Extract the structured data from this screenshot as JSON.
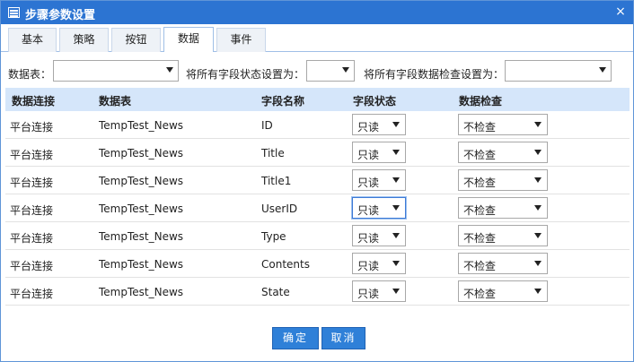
{
  "window": {
    "title": "步骤参数设置",
    "icon": "table-icon",
    "close_glyph": "×"
  },
  "tabs": [
    {
      "label": "基本",
      "active": false
    },
    {
      "label": "策略",
      "active": false
    },
    {
      "label": "按钮",
      "active": false
    },
    {
      "label": "数据",
      "active": true
    },
    {
      "label": "事件",
      "active": false
    }
  ],
  "filters": {
    "table_label": "数据表：",
    "table_value": "",
    "field_status_label": "将所有字段状态设置为：",
    "field_status_value": "",
    "field_check_label": "将所有字段数据检查设置为：",
    "field_check_value": ""
  },
  "grid": {
    "columns": [
      "数据连接",
      "数据表",
      "字段名称",
      "字段状态",
      "数据检查"
    ],
    "rows": [
      {
        "connection": "平台连接",
        "table": "TempTest_News",
        "field": "ID",
        "status": "只读",
        "check": "不检查"
      },
      {
        "connection": "平台连接",
        "table": "TempTest_News",
        "field": "Title",
        "status": "只读",
        "check": "不检查"
      },
      {
        "connection": "平台连接",
        "table": "TempTest_News",
        "field": "Title1",
        "status": "只读",
        "check": "不检查"
      },
      {
        "connection": "平台连接",
        "table": "TempTest_News",
        "field": "UserID",
        "status": "只读",
        "check": "不检查"
      },
      {
        "connection": "平台连接",
        "table": "TempTest_News",
        "field": "Type",
        "status": "只读",
        "check": "不检查"
      },
      {
        "connection": "平台连接",
        "table": "TempTest_News",
        "field": "Contents",
        "status": "只读",
        "check": "不检查"
      },
      {
        "connection": "平台连接",
        "table": "TempTest_News",
        "field": "State",
        "status": "只读",
        "check": "不检查"
      }
    ]
  },
  "buttons": {
    "ok": "确定",
    "cancel": "取消"
  },
  "colors": {
    "titlebar": "#2c74d2",
    "header_bg": "#d5e6fa",
    "button": "#2f80d8"
  }
}
